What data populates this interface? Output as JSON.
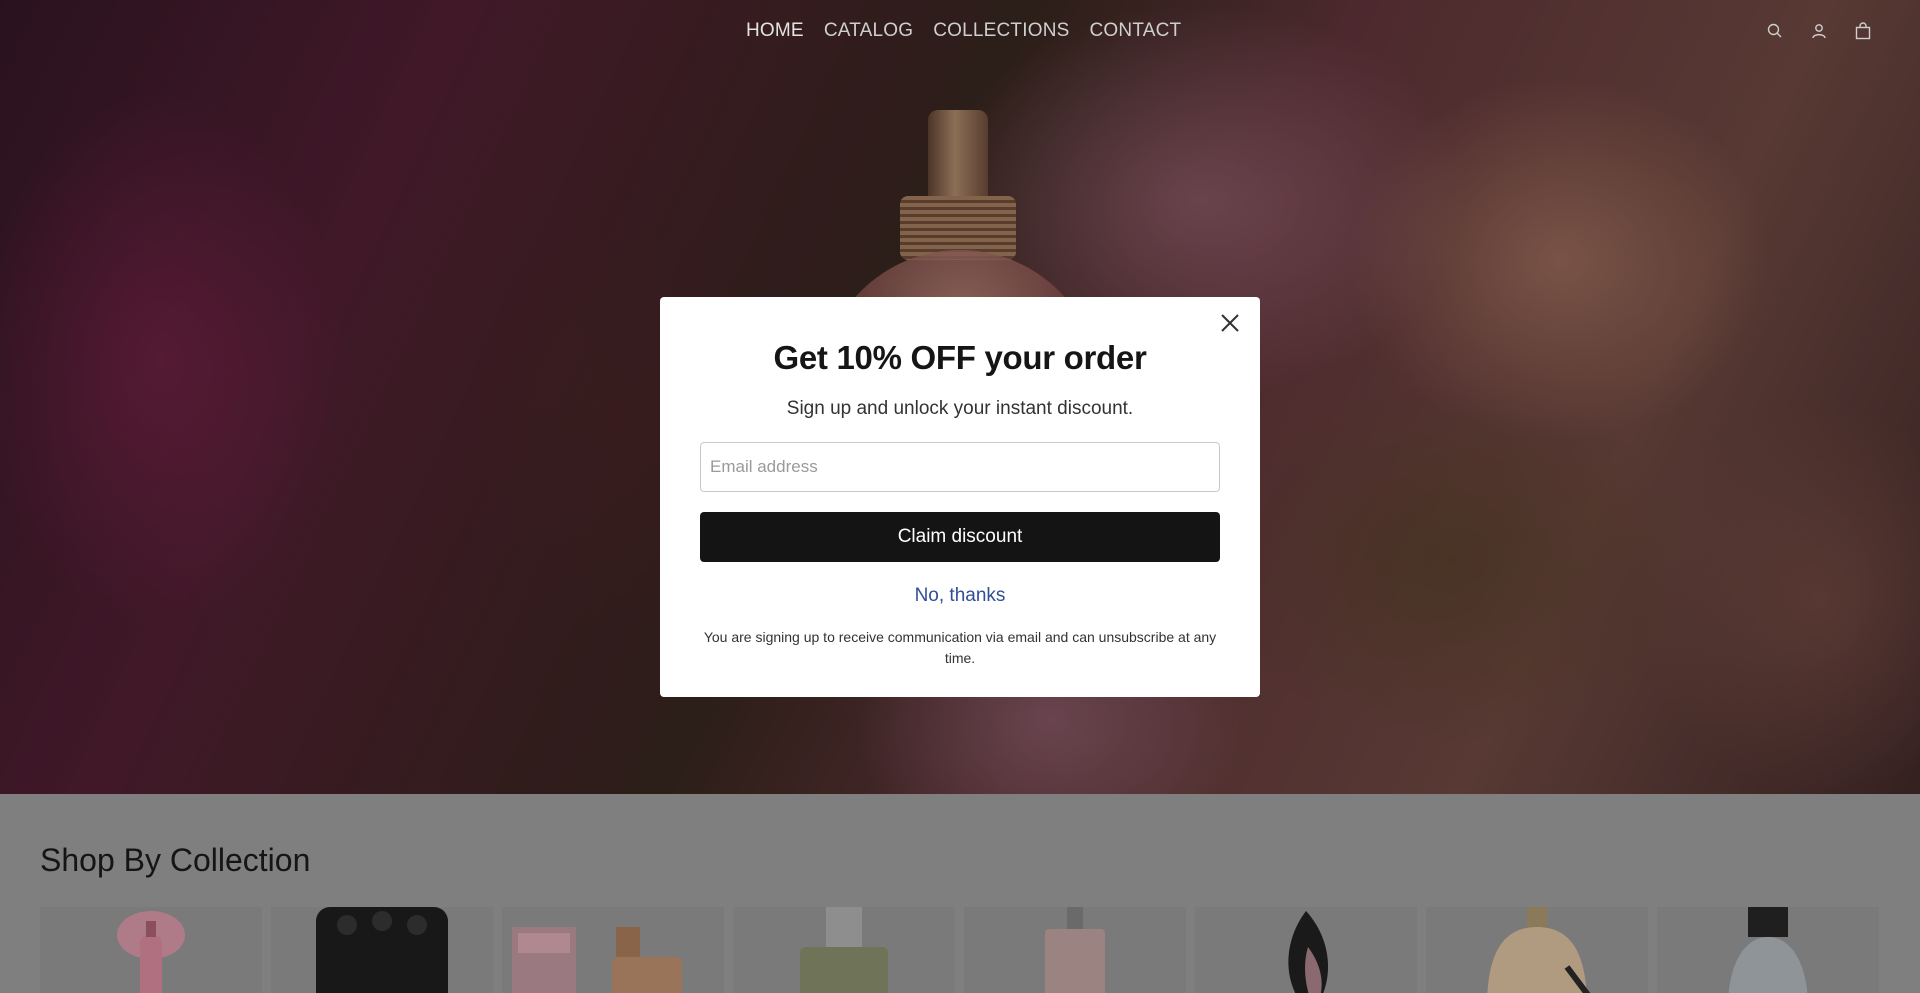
{
  "header": {
    "nav": [
      {
        "label": "HOME"
      },
      {
        "label": "CATALOG"
      },
      {
        "label": "COLLECTIONS"
      },
      {
        "label": "CONTACT"
      }
    ],
    "icons": [
      "search-icon",
      "account-icon",
      "cart-icon"
    ]
  },
  "collections": {
    "title": "Shop By Collection",
    "count": 8
  },
  "modal": {
    "title": "Get 10% OFF your order",
    "subtitle": "Sign up and unlock your instant discount.",
    "email_placeholder": "Email address",
    "email_value": "",
    "claim_label": "Claim discount",
    "decline_label": "No, thanks",
    "disclaimer": "You are signing up to receive communication via email and can unsubscribe at any time.",
    "close_icon": "close-icon"
  },
  "colors": {
    "primary_button": "#141414",
    "link": "#2f4f94",
    "backdrop": "#7f7f7f"
  }
}
